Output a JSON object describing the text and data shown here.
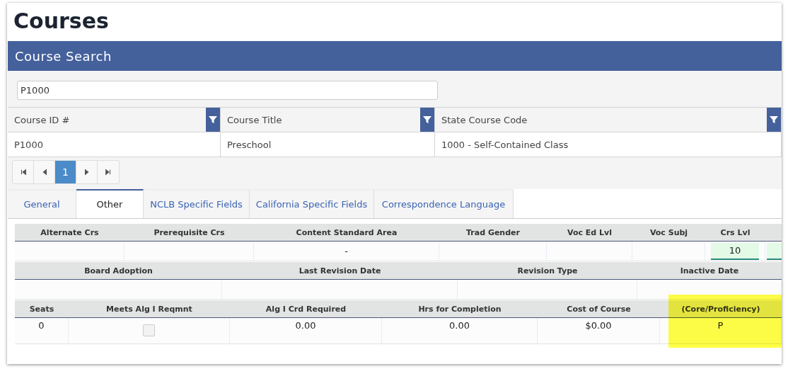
{
  "page": {
    "title": "Courses"
  },
  "search_panel": {
    "title": "Course Search",
    "search": {
      "value": "P1000"
    }
  },
  "grid": {
    "columns": [
      {
        "label": "Course ID #"
      },
      {
        "label": "Course Title"
      },
      {
        "label": "State Course Code"
      }
    ],
    "rows": [
      [
        "P1000",
        "Preschool",
        "1000 - Self-Contained Class"
      ]
    ],
    "pager": {
      "pages": [
        {
          "label": "1",
          "selected": true
        }
      ]
    }
  },
  "tabs": [
    {
      "label": "General",
      "selected": false
    },
    {
      "label": "Other",
      "selected": true
    },
    {
      "label": "NCLB Specific Fields",
      "selected": false
    },
    {
      "label": "California Specific Fields",
      "selected": false
    },
    {
      "label": "Correspondence Language",
      "selected": false
    }
  ],
  "tables": [
    {
      "columns": [
        {
          "label": "Alternate Crs"
        },
        {
          "label": "Prerequisite Crs"
        },
        {
          "label": "Content Standard Area",
          "value": "-"
        },
        {
          "label": "Trad Gender"
        },
        {
          "label": "Voc Ed Lvl"
        },
        {
          "label": "Voc Subj"
        },
        {
          "label": "Crs Lvl",
          "value": "10",
          "kind": "field"
        }
      ]
    },
    {
      "columns": [
        {
          "label": "Board Adoption"
        },
        {
          "label": "Last Revision Date"
        },
        {
          "label": "Revision Type"
        },
        {
          "label": "Inactive Date"
        }
      ]
    },
    {
      "columns": [
        {
          "label": "Seats",
          "value": "0"
        },
        {
          "label": "Meets Alg I Reqmnt",
          "kind": "checkbox",
          "checked": false
        },
        {
          "label": "Alg I Crd Required",
          "value": "0.00"
        },
        {
          "label": "Hrs for Completion",
          "value": "0.00"
        },
        {
          "label": "Cost of Course",
          "value": "$0.00"
        },
        {
          "label": "(Core/Proficiency)",
          "value": "P",
          "highlighted": true
        }
      ]
    }
  ]
}
